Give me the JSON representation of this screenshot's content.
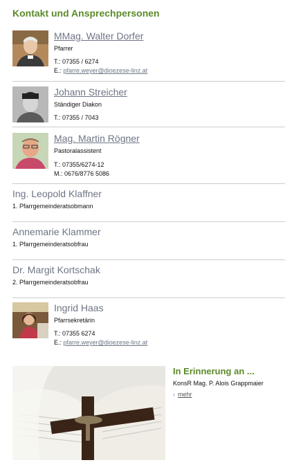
{
  "section_title": "Kontakt und Ansprechpersonen",
  "contacts": [
    {
      "name": "MMag. Walter Dorfer",
      "role": "Pfarrer",
      "phone": "T.: 07355 / 6274",
      "email_prefix": "E.: ",
      "email": "pfarre.weyer@dioezese-linz.at"
    },
    {
      "name": "Johann Streicher",
      "role": "Ständiger Diakon",
      "phone": "T.: 07355 / 7043"
    },
    {
      "name": "Mag. Martin Rögner",
      "role": "Pastoralassistent",
      "phone": "T.: 07355/6274-12",
      "mobile": "M.: 0676/8776 5086"
    },
    {
      "name": "Ing. Leopold Klaffner",
      "role": "1. Pfarrgemeinderatsobmann"
    },
    {
      "name": "Annemarie Klammer",
      "role": "1. Pfarrgemeinderatsobfrau"
    },
    {
      "name": "Dr. Margit Kortschak",
      "role": "2. Pfarrgemeinderatsobfrau"
    },
    {
      "name": "Ingrid Haas",
      "role": "Pfarrsekretärin",
      "phone": "T.: 07355 6274",
      "email_prefix": "E.: ",
      "email": "pfarre.weyer@dioezese-linz.at"
    }
  ],
  "memorial": {
    "title": "In Erinnerung an ...",
    "text": "KonsR Mag. P. Alois Grappmaier",
    "more_arrow": "›",
    "more_label": "mehr"
  },
  "colors": {
    "heading_green": "#5c8a2a",
    "name_gray": "#6d7585",
    "separator": "#cccccc"
  }
}
